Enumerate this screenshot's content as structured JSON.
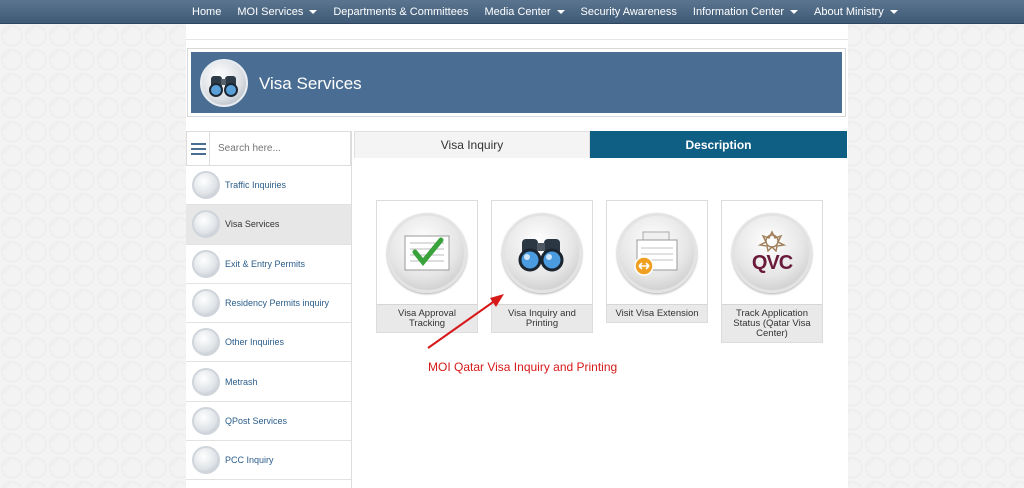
{
  "nav": {
    "items": [
      {
        "label": "Home",
        "dropdown": false
      },
      {
        "label": "MOI Services",
        "dropdown": true
      },
      {
        "label": "Departments & Committees",
        "dropdown": false
      },
      {
        "label": "Media Center",
        "dropdown": true
      },
      {
        "label": "Security Awareness",
        "dropdown": false
      },
      {
        "label": "Information Center",
        "dropdown": true
      },
      {
        "label": "About Ministry",
        "dropdown": true
      }
    ]
  },
  "banner": {
    "title": "Visa Services",
    "icon": "binoculars-icon"
  },
  "sidebar": {
    "search_placeholder": "Search here...",
    "items": [
      {
        "label": "Traffic Inquiries",
        "icon": "traffic-light-icon",
        "active": false
      },
      {
        "label": "Visa Services",
        "icon": "binoculars-icon",
        "active": true
      },
      {
        "label": "Exit & Entry Permits",
        "icon": "airplane-icon",
        "active": false
      },
      {
        "label": "Residency Permits inquiry",
        "icon": "magnifier-icon",
        "active": false
      },
      {
        "label": "Other Inquiries",
        "icon": "exclamation-icon",
        "active": false
      },
      {
        "label": "Metrash",
        "icon": "phone-icon",
        "active": false
      },
      {
        "label": "QPost Services",
        "icon": "truck-icon",
        "active": false
      },
      {
        "label": "PCC Inquiry",
        "icon": "certificate-icon",
        "active": false
      }
    ]
  },
  "tabs": {
    "inquiry": "Visa Inquiry",
    "description": "Description"
  },
  "cards": [
    {
      "label": "Visa Approval Tracking",
      "icon": "approved-document-icon"
    },
    {
      "label": "Visa Inquiry and Printing",
      "icon": "binoculars-icon"
    },
    {
      "label": "Visit Visa Extension",
      "icon": "calendar-extension-icon"
    },
    {
      "label": "Track Application Status (Qatar Visa Center)",
      "icon": "qvc-logo-icon",
      "logo_text": "QVC"
    }
  ],
  "annotation": {
    "text": "MOI Qatar Visa Inquiry and Printing",
    "color": "#d61a1a"
  },
  "colors": {
    "nav_bg": "#4a6580",
    "banner_bg": "#4a6e93",
    "tab_active": "#0f5f85",
    "link": "#2a5d8a"
  }
}
